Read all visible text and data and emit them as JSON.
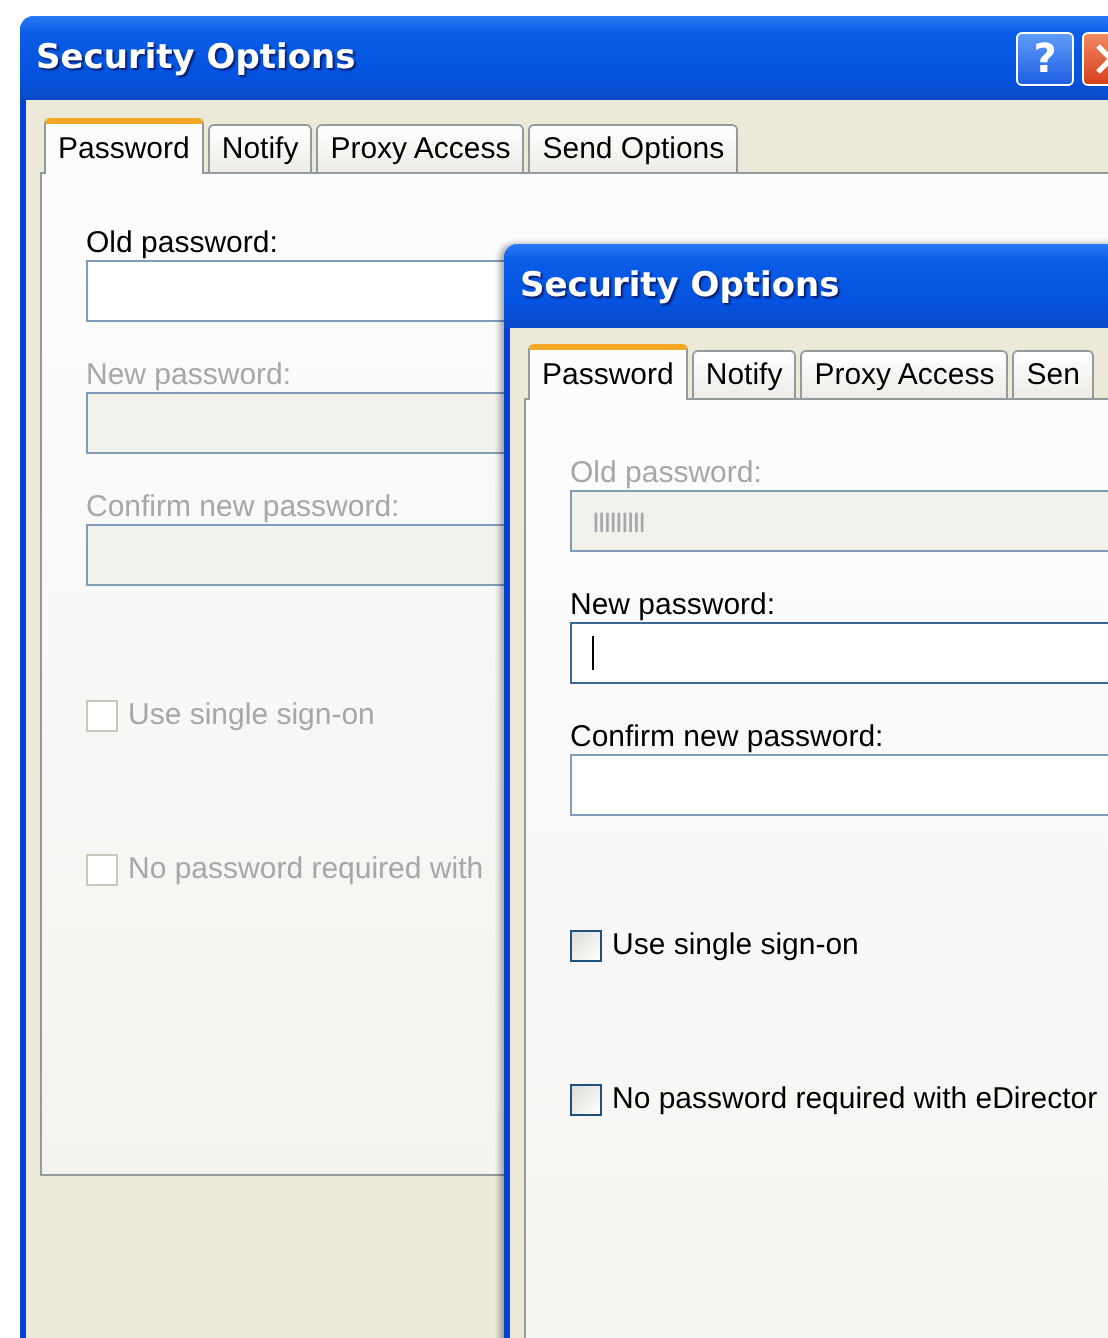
{
  "windows": [
    {
      "title": "Security Options",
      "help_button": "?",
      "has_close": true,
      "tabs": [
        {
          "label": "Password",
          "selected": true
        },
        {
          "label": "Notify",
          "selected": false
        },
        {
          "label": "Proxy Access",
          "selected": false
        },
        {
          "label": "Send Options",
          "selected": false
        }
      ],
      "fields": [
        {
          "label": "Old password:",
          "disabled": false,
          "focused": false
        },
        {
          "label": "New password:",
          "disabled": true,
          "focused": false
        },
        {
          "label": "Confirm new password:",
          "disabled": true,
          "focused": false
        }
      ],
      "checkboxes": [
        {
          "label": "Use single sign-on",
          "checked": false,
          "disabled": true
        },
        {
          "label": "No password required with",
          "checked": false,
          "disabled": true
        }
      ]
    },
    {
      "title": "Security Options",
      "tabs": [
        {
          "label": "Password",
          "selected": true
        },
        {
          "label": "Notify",
          "selected": false
        },
        {
          "label": "Proxy Access",
          "selected": false
        },
        {
          "label": "Sen",
          "selected": false
        }
      ],
      "fields": [
        {
          "label": "Old password:",
          "value": "IIIIIIIII",
          "disabled": true,
          "focused": false
        },
        {
          "label": "New password:",
          "disabled": false,
          "focused": true
        },
        {
          "label": "Confirm new password:",
          "disabled": false,
          "focused": false
        }
      ],
      "checkboxes": [
        {
          "label": "Use single sign-on",
          "checked": false,
          "disabled": false
        },
        {
          "label": "No password required with eDirector",
          "checked": false,
          "disabled": false
        }
      ]
    }
  ]
}
